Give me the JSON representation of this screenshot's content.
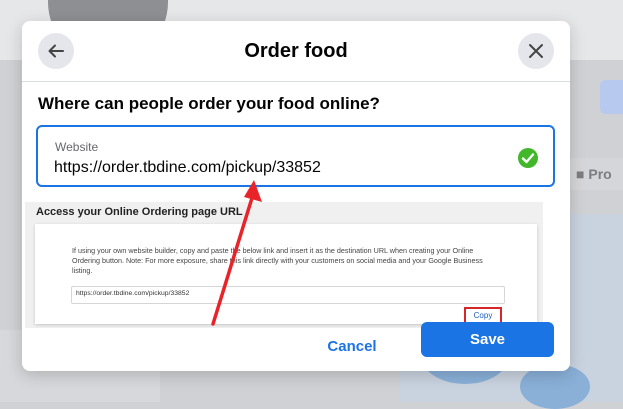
{
  "background": {
    "side_button_label": "Pro"
  },
  "modal": {
    "title": "Order food",
    "back_icon": "arrow-left-icon",
    "close_icon": "close-icon"
  },
  "form": {
    "question": "Where can people order your food online?",
    "website_label": "Website",
    "website_value": "https://order.tbdine.com/pickup/33852",
    "valid_icon": "check-circle-icon",
    "valid_color": "#42b72a"
  },
  "embedded": {
    "title": "Access your Online Ordering page URL",
    "instructions": "If using your own website builder, copy and paste the below link and insert it as the destination URL when creating your Online Ordering button. Note: For more exposure, share this link directly with your customers on social media and your Google Business listing.",
    "url": "https://order.tbdine.com/pickup/33852",
    "copy_label": "Copy",
    "highlight_color": "#d6262a"
  },
  "actions": {
    "cancel_label": "Cancel",
    "save_label": "Save",
    "primary_color": "#1b74e4"
  }
}
